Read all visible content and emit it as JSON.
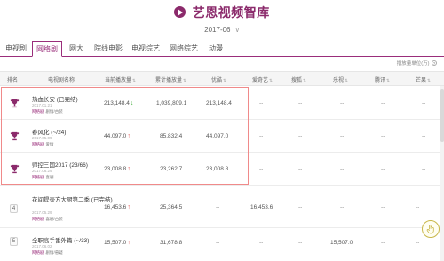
{
  "brand": {
    "name": "艺恩视频智库"
  },
  "date_filter": {
    "value": "2017-06",
    "caret": "∨"
  },
  "tabs": [
    {
      "label": "电视剧"
    },
    {
      "label": "网络剧",
      "active": true
    },
    {
      "label": "网大"
    },
    {
      "label": "院线电影"
    },
    {
      "label": "电视综艺"
    },
    {
      "label": "网络综艺"
    },
    {
      "label": "动漫"
    }
  ],
  "note": {
    "text": "播放量单位(万)",
    "icon": "?"
  },
  "table": {
    "columns": [
      "排名",
      "电视剧名称",
      "当前播放量",
      "累计播放量",
      "优酷",
      "爱奇艺",
      "搜狐",
      "乐视",
      "腾讯",
      "芒果"
    ],
    "sort_icon": "⇅",
    "rows": [
      {
        "rank_icon": "trophy-icon",
        "title": "热血长安 (已完结)",
        "date": "2017.01.21",
        "source": "网络剧",
        "platforms": "剧情/古装",
        "current": "213,148.4",
        "trend": "down",
        "total": "1,039,809.1",
        "youku": "213,148.4",
        "iqiyi": "--",
        "sohu": "--",
        "letv": "--",
        "tencent": "--",
        "mango": "--"
      },
      {
        "rank_icon": "trophy-icon",
        "title": "春风化 (~/24)",
        "date": "2017.05.09",
        "source": "网络剧",
        "platforms": "爱情",
        "current": "44,097.0",
        "trend": "up",
        "total": "85,832.4",
        "youku": "44,097.0",
        "iqiyi": "--",
        "sohu": "--",
        "letv": "--",
        "tencent": "--",
        "mango": "--"
      },
      {
        "rank_icon": "trophy-icon",
        "title": "师控三国2017 (23/66)",
        "date": "2017.06.29",
        "source": "网络剧",
        "platforms": "喜剧",
        "current": "23,008.8",
        "trend": "up",
        "total": "23,262.7",
        "youku": "23,008.8",
        "iqiyi": "--",
        "sohu": "--",
        "letv": "--",
        "tencent": "--",
        "mango": "--"
      },
      {
        "rank": "4",
        "title": "花间提壶方大厨第二季 (已完结)",
        "date": "2017.05.29",
        "source": "网络剧",
        "platforms": "喜剧/古装",
        "current": "16,453.6",
        "trend": "up",
        "total": "25,364.5",
        "youku": "--",
        "iqiyi": "16,453.6",
        "sohu": "--",
        "letv": "--",
        "tencent": "--",
        "mango": "--"
      },
      {
        "rank": "5",
        "title": "全职高手番外篇 (~/33)",
        "date": "2017.06.02",
        "source": "网络剧",
        "platforms": "剧情/悬疑",
        "current": "15,507.0",
        "trend": "up",
        "total": "31,678.8",
        "youku": "--",
        "iqiyi": "--",
        "sohu": "--",
        "letv": "15,507.0",
        "tencent": "--",
        "mango": "--"
      }
    ]
  },
  "colors": {
    "accent": "#9a2d7b",
    "highlight": "#f08a8a",
    "up": "#e14c4c",
    "down": "#3aaa35"
  }
}
